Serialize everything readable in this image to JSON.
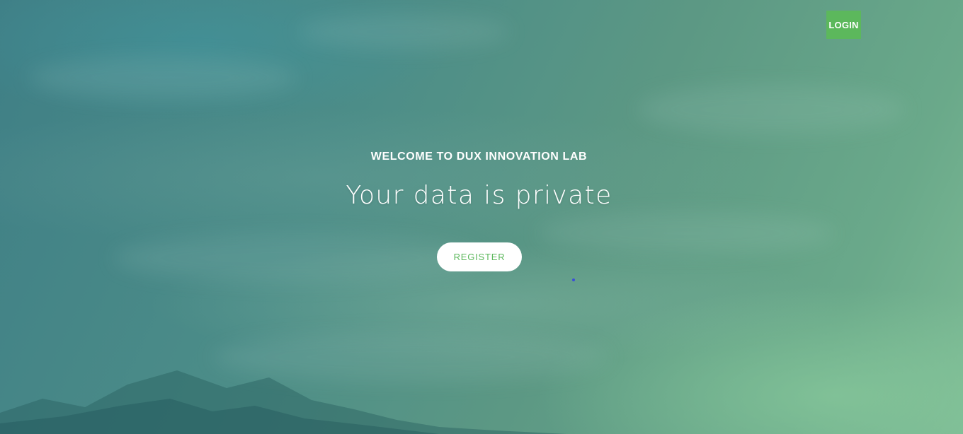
{
  "header": {
    "login_label": "LOGIN"
  },
  "hero": {
    "eyebrow": "WELCOME TO DUX INNOVATION LAB",
    "title": "Your data is private",
    "register_label": "REGISTER"
  },
  "colors": {
    "accent": "#5cb85c",
    "text": "#ffffff",
    "background_start": "#3f7f86",
    "background_end": "#7dbb95"
  }
}
